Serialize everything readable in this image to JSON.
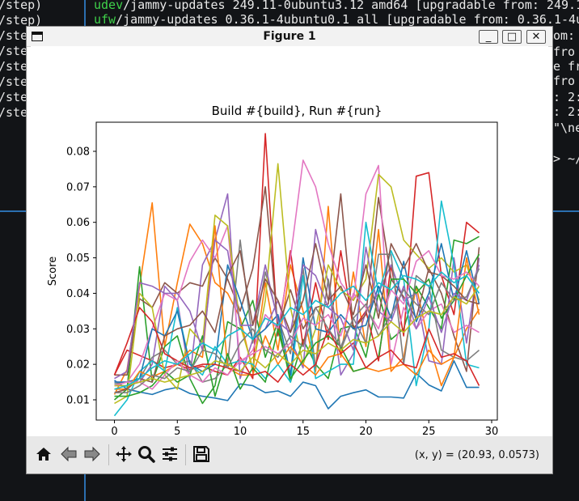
{
  "terminal": {
    "lines": [
      {
        "text": "/step)",
        "accent": ""
      },
      {
        "text": "/step)",
        "accent": ""
      },
      {
        "text": "/step",
        "accent": ""
      },
      {
        "text": "/step",
        "accent": ""
      },
      {
        "text": "/step",
        "accent": ""
      },
      {
        "text": "/step",
        "accent": ""
      },
      {
        "text": "/step",
        "accent": ""
      },
      {
        "text": "/step",
        "accent": ""
      }
    ],
    "right_lines": [
      {
        "pkg": "udev",
        "rest": "/jammy-updates 249.11-0ubuntu3.12 amd64 [upgradable from: 249.1"
      },
      {
        "pkg": "ufw",
        "rest": "/jammy-updates 0.36.1-4ubuntu0.1 all [upgradable from: 0.36.1-4u"
      },
      {
        "pkg": "",
        "rest": "om:"
      },
      {
        "pkg": "",
        "rest": "fro"
      },
      {
        "pkg": "",
        "rest": "e fr"
      },
      {
        "pkg": "",
        "rest": "fro"
      },
      {
        "pkg": "",
        "rest": ": 2:"
      },
      {
        "pkg": "",
        "rest": ": 2:"
      },
      {
        "pkg": "",
        "rest": "\"\\ne"
      },
      {
        "pkg": "",
        "rest": ""
      },
      {
        "pkg": "",
        "rest": "> ~/"
      }
    ]
  },
  "window": {
    "title": "Figure 1",
    "minimize_label": "_",
    "maximize_label": "□",
    "close_label": "✕"
  },
  "toolbar": {
    "tools": [
      "home-icon",
      "back-arrow-icon",
      "forward-arrow-icon",
      "pan-icon",
      "zoom-icon",
      "configure-subplots-icon",
      "save-icon"
    ],
    "coords_text": "(x, y) = (20.93, 0.0573)"
  },
  "chart_data": {
    "type": "line",
    "title": "Build #{build}, Run #{run}",
    "xlabel": "Generation",
    "ylabel": "Score",
    "xlim": [
      -1.45,
      30.45
    ],
    "ylim": [
      0.0043,
      0.0882
    ],
    "xticks": [
      0,
      5,
      10,
      15,
      20,
      25,
      30
    ],
    "yticks": [
      0.01,
      0.02,
      0.03,
      0.04,
      0.05,
      0.06,
      0.07,
      0.08
    ],
    "ytick_labels": [
      "0.01",
      "0.02",
      "0.03",
      "0.04",
      "0.05",
      "0.06",
      "0.07",
      "0.08"
    ],
    "grid": false,
    "legend": "none",
    "x": [
      0,
      1,
      2,
      3,
      4,
      5,
      6,
      7,
      8,
      9,
      10,
      11,
      12,
      13,
      14,
      15,
      16,
      17,
      18,
      19,
      20,
      21,
      22,
      23,
      24,
      25,
      26,
      27,
      28,
      29
    ],
    "series": [
      {
        "color": "#1f77b4",
        "values": [
          0.0155,
          0.013,
          0.0122,
          0.0115,
          0.0128,
          0.0135,
          0.0118,
          0.011,
          0.0105,
          0.0098,
          0.0145,
          0.014,
          0.012,
          0.0125,
          0.011,
          0.015,
          0.014,
          0.0075,
          0.011,
          0.012,
          0.0128,
          0.0108,
          0.0108,
          0.0105,
          0.0175,
          0.0142,
          0.0125,
          0.021,
          0.0135,
          0.0135
        ]
      },
      {
        "color": "#ff7f0e",
        "values": [
          0.0115,
          0.0185,
          0.042,
          0.0655,
          0.025,
          0.043,
          0.0595,
          0.054,
          0.043,
          0.04,
          0.033,
          0.018,
          0.043,
          0.024,
          0.048,
          0.035,
          0.018,
          0.0645,
          0.022,
          0.046,
          0.025,
          0.058,
          0.018,
          0.022,
          0.042,
          0.026,
          0.014,
          0.022,
          0.03,
          0.0355
        ]
      },
      {
        "color": "#2ca02c",
        "values": [
          0.01,
          0.013,
          0.0475,
          0.015,
          0.025,
          0.028,
          0.016,
          0.009,
          0.014,
          0.032,
          0.03,
          0.038,
          0.022,
          0.032,
          0.015,
          0.027,
          0.02,
          0.016,
          0.03,
          0.031,
          0.022,
          0.04,
          0.027,
          0.03,
          0.042,
          0.036,
          0.03,
          0.055,
          0.054,
          0.056
        ]
      },
      {
        "color": "#d62728",
        "values": [
          0.017,
          0.024,
          0.0225,
          0.021,
          0.019,
          0.02,
          0.0185,
          0.0195,
          0.018,
          0.017,
          0.022,
          0.016,
          0.085,
          0.028,
          0.052,
          0.025,
          0.043,
          0.027,
          0.052,
          0.03,
          0.035,
          0.021,
          0.048,
          0.028,
          0.073,
          0.074,
          0.045,
          0.034,
          0.06,
          0.057
        ]
      },
      {
        "color": "#9467bd",
        "values": [
          0.014,
          0.014,
          0.015,
          0.02,
          0.042,
          0.038,
          0.016,
          0.048,
          0.055,
          0.068,
          0.016,
          0.027,
          0.03,
          0.038,
          0.027,
          0.019,
          0.058,
          0.043,
          0.017,
          0.023,
          0.035,
          0.04,
          0.048,
          0.038,
          0.04,
          0.021,
          0.02,
          0.05,
          0.026,
          0.05
        ]
      },
      {
        "color": "#8c564b",
        "values": [
          0.017,
          0.017,
          0.0385,
          0.036,
          0.043,
          0.04,
          0.043,
          0.042,
          0.05,
          0.044,
          0.035,
          0.047,
          0.07,
          0.03,
          0.041,
          0.03,
          0.036,
          0.037,
          0.068,
          0.03,
          0.034,
          0.067,
          0.044,
          0.039,
          0.033,
          0.047,
          0.04,
          0.028,
          0.018,
          0.053
        ]
      },
      {
        "color": "#e377c2",
        "values": [
          0.015,
          0.015,
          0.02,
          0.03,
          0.04,
          0.038,
          0.049,
          0.055,
          0.05,
          0.059,
          0.02,
          0.024,
          0.034,
          0.03,
          0.05,
          0.0775,
          0.07,
          0.054,
          0.043,
          0.038,
          0.068,
          0.076,
          0.02,
          0.036,
          0.03,
          0.035,
          0.037,
          0.029,
          0.031,
          0.029
        ]
      },
      {
        "color": "#7f7f7f",
        "values": [
          0.0145,
          0.015,
          0.016,
          0.022,
          0.024,
          0.02,
          0.021,
          0.015,
          0.016,
          0.02,
          0.055,
          0.026,
          0.046,
          0.033,
          0.023,
          0.047,
          0.019,
          0.044,
          0.024,
          0.033,
          0.026,
          0.051,
          0.051,
          0.02,
          0.045,
          0.042,
          0.024,
          0.022,
          0.021,
          0.024
        ]
      },
      {
        "color": "#bcbd22",
        "values": [
          0.009,
          0.011,
          0.04,
          0.036,
          0.017,
          0.013,
          0.03,
          0.026,
          0.062,
          0.059,
          0.031,
          0.019,
          0.038,
          0.0765,
          0.036,
          0.02,
          0.03,
          0.048,
          0.041,
          0.038,
          0.044,
          0.0735,
          0.07,
          0.055,
          0.051,
          0.047,
          0.05,
          0.046,
          0.048,
          0.038
        ]
      },
      {
        "color": "#17becf",
        "values": [
          0.0055,
          0.01,
          0.018,
          0.021,
          0.018,
          0.036,
          0.02,
          0.017,
          0.025,
          0.02,
          0.021,
          0.02,
          0.016,
          0.02,
          0.015,
          0.045,
          0.016,
          0.018,
          0.02,
          0.02,
          0.06,
          0.04,
          0.052,
          0.044,
          0.014,
          0.03,
          0.066,
          0.048,
          0.02,
          0.019
        ]
      },
      {
        "color": "#1f77b4",
        "values": [
          0.015,
          0.015,
          0.016,
          0.03,
          0.028,
          0.035,
          0.02,
          0.018,
          0.02,
          0.048,
          0.038,
          0.027,
          0.03,
          0.034,
          0.017,
          0.05,
          0.03,
          0.029,
          0.034,
          0.03,
          0.031,
          0.042,
          0.033,
          0.049,
          0.032,
          0.04,
          0.054,
          0.038,
          0.052,
          0.037
        ]
      },
      {
        "color": "#ff7f0e",
        "values": [
          0.013,
          0.013,
          0.018,
          0.0165,
          0.018,
          0.02,
          0.024,
          0.022,
          0.059,
          0.019,
          0.017,
          0.017,
          0.028,
          0.02,
          0.025,
          0.02,
          0.017,
          0.022,
          0.023,
          0.018,
          0.019,
          0.018,
          0.019,
          0.02,
          0.017,
          0.024,
          0.02,
          0.022,
          0.05,
          0.034
        ]
      },
      {
        "color": "#2ca02c",
        "values": [
          0.011,
          0.011,
          0.012,
          0.014,
          0.018,
          0.015,
          0.017,
          0.028,
          0.011,
          0.023,
          0.013,
          0.019,
          0.015,
          0.03,
          0.016,
          0.021,
          0.026,
          0.028,
          0.025,
          0.018,
          0.019,
          0.022,
          0.044,
          0.044,
          0.04,
          0.044,
          0.033,
          0.038,
          0.045,
          0.051
        ]
      },
      {
        "color": "#d62728",
        "values": [
          0.017,
          0.026,
          0.036,
          0.032,
          0.023,
          0.021,
          0.019,
          0.02,
          0.02,
          0.019,
          0.018,
          0.017,
          0.018,
          0.015,
          0.02,
          0.017,
          0.02,
          0.03,
          0.023,
          0.026,
          0.019,
          0.022,
          0.024,
          0.02,
          0.019,
          0.03,
          0.022,
          0.023,
          0.021,
          0.014
        ]
      },
      {
        "color": "#9467bd",
        "values": [
          0.016,
          0.018,
          0.043,
          0.042,
          0.04,
          0.04,
          0.035,
          0.024,
          0.055,
          0.052,
          0.031,
          0.031,
          0.048,
          0.032,
          0.029,
          0.048,
          0.045,
          0.036,
          0.033,
          0.024,
          0.053,
          0.035,
          0.032,
          0.042,
          0.03,
          0.039,
          0.029,
          0.04,
          0.038,
          0.048
        ]
      },
      {
        "color": "#8c564b",
        "values": [
          0.012,
          0.013,
          0.016,
          0.015,
          0.028,
          0.03,
          0.031,
          0.035,
          0.029,
          0.045,
          0.052,
          0.031,
          0.044,
          0.038,
          0.029,
          0.038,
          0.054,
          0.038,
          0.042,
          0.034,
          0.048,
          0.033,
          0.054,
          0.047,
          0.054,
          0.046,
          0.045,
          0.042,
          0.038,
          0.037
        ]
      },
      {
        "color": "#e377c2",
        "values": [
          0.014,
          0.015,
          0.015,
          0.013,
          0.017,
          0.021,
          0.017,
          0.015,
          0.019,
          0.017,
          0.021,
          0.023,
          0.025,
          0.023,
          0.026,
          0.033,
          0.031,
          0.034,
          0.028,
          0.04,
          0.036,
          0.03,
          0.041,
          0.037,
          0.049,
          0.052,
          0.045,
          0.044,
          0.046,
          0.042
        ]
      },
      {
        "color": "#7f7f7f",
        "values": [
          0.012,
          0.012,
          0.014,
          0.017,
          0.016,
          0.019,
          0.018,
          0.024,
          0.023,
          0.019,
          0.026,
          0.03,
          0.024,
          0.022,
          0.028,
          0.025,
          0.036,
          0.03,
          0.025,
          0.033,
          0.037,
          0.028,
          0.034,
          0.041,
          0.037,
          0.034,
          0.043,
          0.038,
          0.039,
          0.047
        ]
      },
      {
        "color": "#bcbd22",
        "values": [
          0.014,
          0.014,
          0.015,
          0.016,
          0.015,
          0.016,
          0.017,
          0.018,
          0.021,
          0.02,
          0.018,
          0.022,
          0.019,
          0.023,
          0.02,
          0.024,
          0.023,
          0.026,
          0.024,
          0.027,
          0.026,
          0.028,
          0.032,
          0.029,
          0.033,
          0.035,
          0.034,
          0.039,
          0.037,
          0.042
        ]
      },
      {
        "color": "#17becf",
        "values": [
          0.013,
          0.014,
          0.016,
          0.019,
          0.021,
          0.02,
          0.023,
          0.026,
          0.024,
          0.028,
          0.03,
          0.027,
          0.033,
          0.031,
          0.036,
          0.034,
          0.038,
          0.036,
          0.04,
          0.042,
          0.038,
          0.043,
          0.041,
          0.045,
          0.044,
          0.042,
          0.046,
          0.043,
          0.045,
          0.04
        ]
      }
    ]
  }
}
